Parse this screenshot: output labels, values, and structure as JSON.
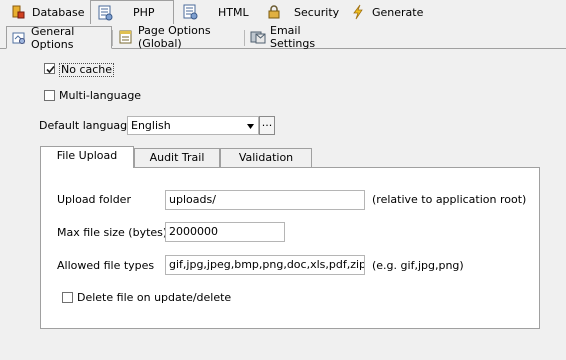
{
  "top_tabs": [
    {
      "label": "Database",
      "icon": "database-icon"
    },
    {
      "label": "PHP",
      "icon": "php-settings-icon"
    },
    {
      "label": "HTML",
      "icon": "html-settings-icon"
    },
    {
      "label": "Security",
      "icon": "lock-icon"
    },
    {
      "label": "Generate",
      "icon": "lightning-icon"
    }
  ],
  "sub_tabs": [
    {
      "label": "General Options",
      "icon": "general-options-icon"
    },
    {
      "label": "Page Options (Global)",
      "icon": "page-options-icon"
    },
    {
      "label": "Email Settings",
      "icon": "email-settings-icon"
    }
  ],
  "options": {
    "no_cache": {
      "label": "No cache",
      "checked": true
    },
    "multi_language": {
      "label": "Multi-language",
      "checked": false
    },
    "default_language": {
      "label": "Default language",
      "value": "English",
      "more_button": "..."
    }
  },
  "inner_tabs": [
    {
      "label": "File Upload"
    },
    {
      "label": "Audit Trail"
    },
    {
      "label": "Validation"
    }
  ],
  "file_upload": {
    "upload_folder": {
      "label": "Upload folder",
      "value": "uploads/",
      "hint": "(relative to application root)"
    },
    "max_file_size": {
      "label": "Max file size (bytes)",
      "value": "2000000"
    },
    "allowed_file_types": {
      "label": "Allowed file types",
      "value": "gif,jpg,jpeg,bmp,png,doc,xls,pdf,zip",
      "hint": "(e.g. gif,jpg,png)"
    },
    "delete_on_update": {
      "label": "Delete file on update/delete",
      "checked": false
    }
  }
}
